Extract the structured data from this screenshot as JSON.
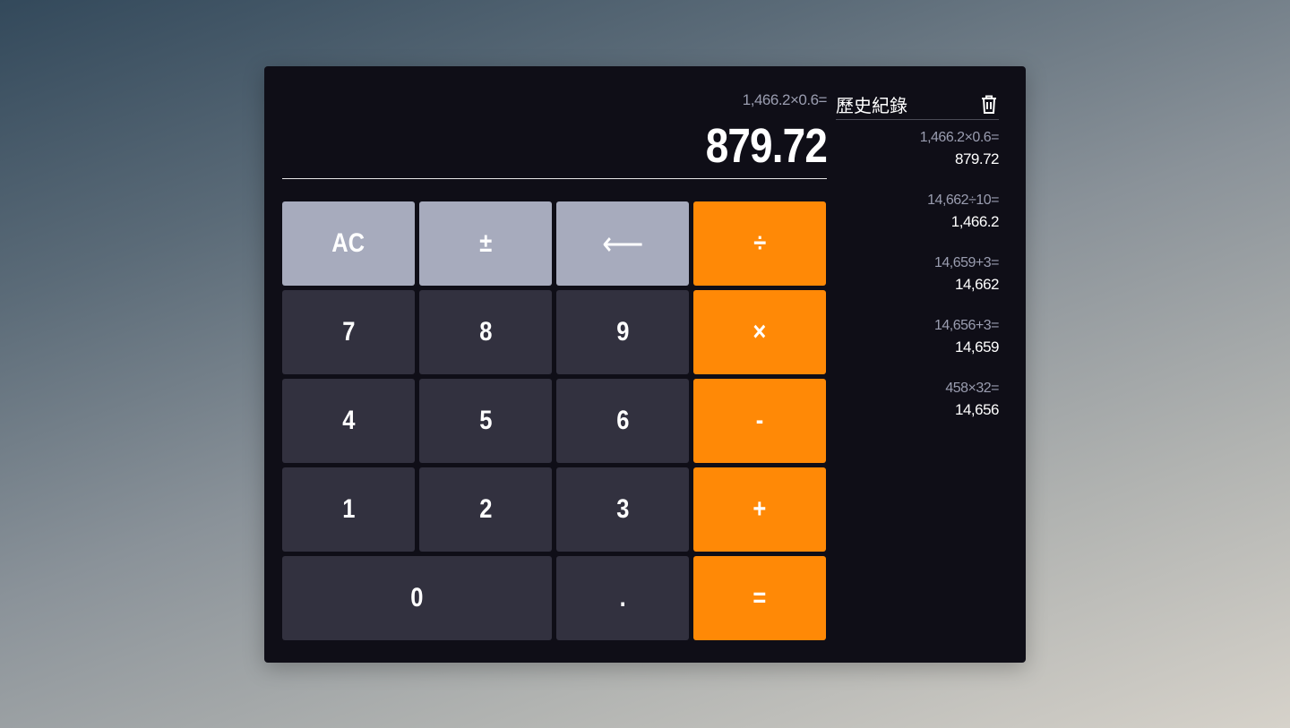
{
  "display": {
    "expression": "1,466.2×0.6=",
    "result": "879.72"
  },
  "keypad": {
    "ac": "AC",
    "sign": "±",
    "backspace": "⟵",
    "divide": "÷",
    "seven": "7",
    "eight": "8",
    "nine": "9",
    "multiply": "×",
    "four": "4",
    "five": "5",
    "six": "6",
    "minus": "-",
    "one": "1",
    "two": "2",
    "three": "3",
    "plus": "+",
    "zero": "0",
    "decimal": ".",
    "equals": "="
  },
  "history": {
    "title": "歷史紀錄",
    "clear_icon": "trash-icon",
    "items": [
      {
        "expression": "1,466.2×0.6=",
        "result": "879.72"
      },
      {
        "expression": "14,662÷10=",
        "result": "1,466.2"
      },
      {
        "expression": "14,659+3=",
        "result": "14,662"
      },
      {
        "expression": "14,656+3=",
        "result": "14,659"
      },
      {
        "expression": "458×32=",
        "result": "14,656"
      }
    ]
  },
  "colors": {
    "panel": "#0f0e17",
    "key_number": "#32313f",
    "key_function": "#a7abbd",
    "key_operator": "#ff8906"
  }
}
